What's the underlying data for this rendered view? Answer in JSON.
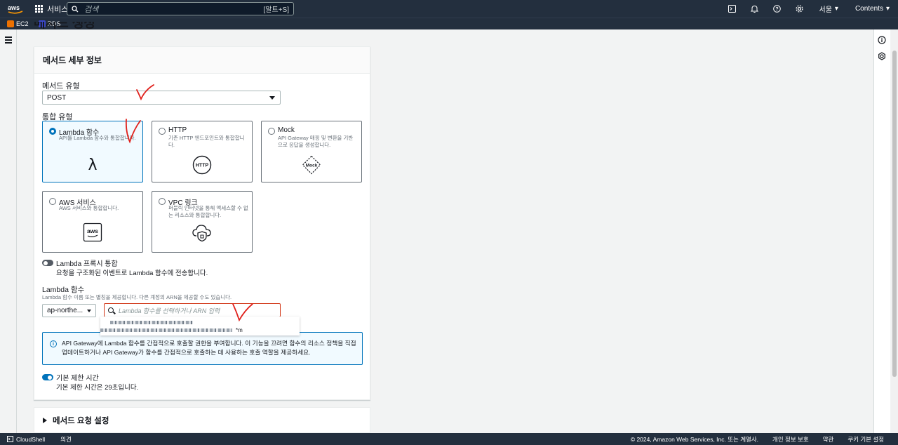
{
  "topnav": {
    "logo_text": "aws",
    "services_label": "서비스",
    "search_placeholder": "검색",
    "search_shortcut": "[알트+S]",
    "region_label": "서울",
    "account_label": "Contents",
    "icons": [
      "cloudshell-icon",
      "bell-icon",
      "help-icon",
      "gear-icon"
    ]
  },
  "favorites": [
    {
      "label": "EC2",
      "color": "#ed7100"
    },
    {
      "label": "RDS",
      "color": "#3b48cc"
    }
  ],
  "page": {
    "peek_title": "메서드 생성"
  },
  "method_details": {
    "heading": "메서드 세부 정보",
    "method_type_label": "메서드 유형",
    "method_type_value": "POST",
    "integration_type_label": "통합 유형",
    "tiles": [
      {
        "title": "Lambda 함수",
        "desc": "API를 Lambda 함수와 통합합니다.",
        "selected": true,
        "art": "λ"
      },
      {
        "title": "HTTP",
        "desc": "기존 HTTP 엔드포인트와 통합합니다.",
        "selected": false,
        "art": "HTTP"
      },
      {
        "title": "Mock",
        "desc": "API Gateway 매핑 및 변환을 기반으로 응답을 생성합니다.",
        "selected": false,
        "art": "Mock"
      },
      {
        "title": "AWS 서비스",
        "desc": "AWS 서비스와 통합합니다.",
        "selected": false,
        "art": "aws"
      },
      {
        "title": "VPC 링크",
        "desc": "퍼블릭 인터넷을 통해 액세스할 수 없는 리소스와 통합합니다.",
        "selected": false,
        "art": "vpc"
      }
    ],
    "proxy_toggle_label": "Lambda 프록시 통합",
    "proxy_toggle_desc": "요청을 구조화된 이벤트로 Lambda 함수에 전송합니다.",
    "proxy_toggle_on": false,
    "lambda_fn_label": "Lambda 함수",
    "lambda_fn_desc": "Lambda 함수 이름 또는 별칭을 제공합니다. 다른 계정의 ARN을 제공할 수도 있습니다.",
    "region_value": "ap-northe...",
    "fn_placeholder": "Lambda 함수를 선택하거나 ARN 입력",
    "dropdown_suffix": "*m",
    "info_text": "API Gateway에 Lambda 함수를 간접적으로 호출할 권한을 부여합니다. 이 기능을 끄려면 함수의 리소스 정책을 직접 업데이트하거나 API Gateway가 함수를 간접적으로 호출하는 데 사용하는 호출 역할을 제공하세요.",
    "timeout_toggle_label": "기본 제한 시간",
    "timeout_toggle_desc": "기본 제한 시간은 29초입니다.",
    "timeout_toggle_on": true
  },
  "request_settings": {
    "heading": "메서드 요청 설정"
  },
  "footer": {
    "cloudshell": "CloudShell",
    "feedback": "의견",
    "copyright": "© 2024, Amazon Web Services, Inc. 또는 계열사.",
    "privacy": "개인 정보 보호",
    "terms": "약관",
    "cookies": "쿠키 기본 설정"
  },
  "colors": {
    "nav_bg": "#232f3e",
    "accent_blue": "#0073bb",
    "error_red": "#d13212",
    "annotation_red": "#e0201b"
  }
}
